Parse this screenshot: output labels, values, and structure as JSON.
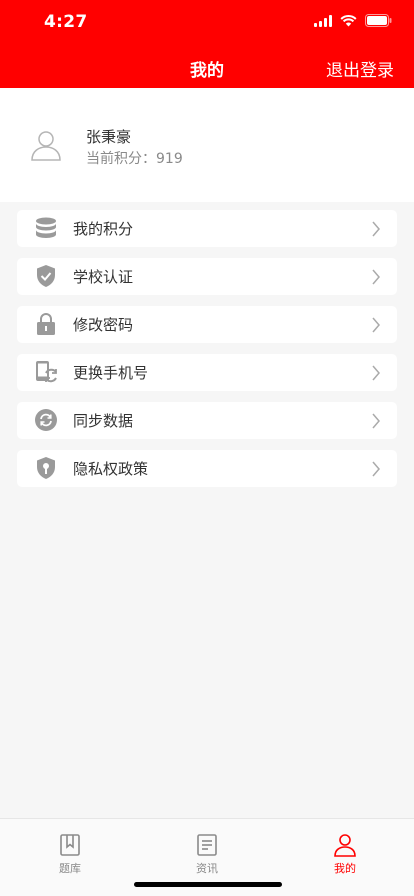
{
  "status_bar": {
    "time": "4:27"
  },
  "header": {
    "title": "我的",
    "logout_label": "退出登录"
  },
  "profile": {
    "name": "张秉豪",
    "points_text": "当前积分：919"
  },
  "menu": [
    {
      "icon": "database-icon",
      "label": "我的积分"
    },
    {
      "icon": "shield-check-icon",
      "label": "学校认证"
    },
    {
      "icon": "lock-icon",
      "label": "修改密码"
    },
    {
      "icon": "phone-swap-icon",
      "label": "更换手机号"
    },
    {
      "icon": "sync-icon",
      "label": "同步数据"
    },
    {
      "icon": "privacy-shield-icon",
      "label": "隐私权政策"
    }
  ],
  "tabbar": {
    "active": "我的",
    "tabs": [
      {
        "icon": "book-icon",
        "label": "题库"
      },
      {
        "icon": "news-icon",
        "label": "资讯"
      },
      {
        "icon": "person-icon",
        "label": "我的"
      }
    ]
  },
  "colors": {
    "accent": "#ff0000",
    "icon_gray": "#9a9a9a",
    "background": "#f6f6f6"
  }
}
